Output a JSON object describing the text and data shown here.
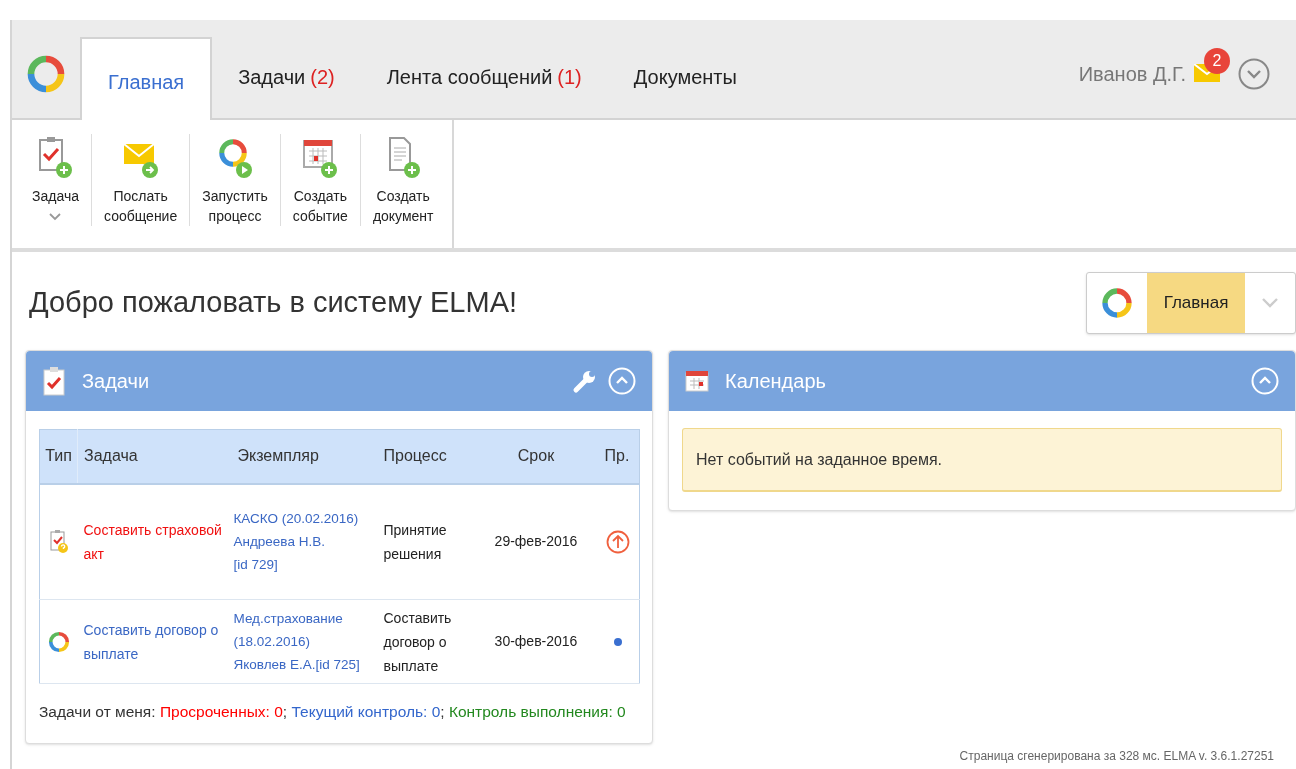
{
  "header": {
    "tabs": [
      {
        "label": "Главная",
        "selected": true
      },
      {
        "label": "Задачи",
        "count": "(2)",
        "selected": false
      },
      {
        "label": "Лента сообщений",
        "count": "(1)",
        "selected": false
      },
      {
        "label": "Документы",
        "selected": false
      }
    ],
    "user": "Иванов Д.Г.",
    "unread": "2"
  },
  "toolbar": [
    {
      "kind": "task",
      "lines": [
        "Задача"
      ],
      "dropdown": true
    },
    {
      "kind": "message",
      "lines": [
        "Послать",
        "сообщение"
      ],
      "dropdown": false
    },
    {
      "kind": "process",
      "lines": [
        "Запустить",
        "процесс"
      ],
      "dropdown": false
    },
    {
      "kind": "event",
      "lines": [
        "Создать",
        "событие"
      ],
      "dropdown": false
    },
    {
      "kind": "document",
      "lines": [
        "Создать",
        "документ"
      ],
      "dropdown": false
    }
  ],
  "page_title": "Добро пожаловать в систему ELMA!",
  "page_switcher": {
    "label": "Главная"
  },
  "tasks_panel": {
    "title": "Задачи",
    "columns": [
      "Тип",
      "Задача",
      "Экземпляр",
      "Процесс",
      "Срок",
      "Пр."
    ],
    "rows": [
      {
        "kind": "task",
        "task": "Составить страховой акт",
        "overdue": true,
        "instance": [
          "КАСКО (20.02.2016)",
          "Андреева Н.В.",
          "[id 729]"
        ],
        "process": "Принятие решения",
        "due": "29-фев-2016",
        "high_priority": true
      },
      {
        "kind": "process",
        "task": "Составить договор о выплате",
        "overdue": false,
        "instance": [
          "Мед.страхование",
          "(18.02.2016)",
          "Яковлев Е.А.[id 725]"
        ],
        "process": "Составить договор о выплате",
        "due": "30-фев-2016",
        "high_priority": false
      }
    ],
    "summary": {
      "label": "Задачи от меня:",
      "separator": ";",
      "parts": [
        {
          "text": "Просроченных: 0",
          "color": "#ff0000"
        },
        {
          "text": "Текущий контроль: 0",
          "color": "#3366cc"
        },
        {
          "text": "Контроль выполнения: 0",
          "color": "#22881e"
        }
      ]
    }
  },
  "calendar_panel": {
    "title": "Календарь",
    "message": "Нет событий на заданное время."
  },
  "footer": "Страница сгенерирована за 328 мс. ELMA v. 3.6.1.27251"
}
